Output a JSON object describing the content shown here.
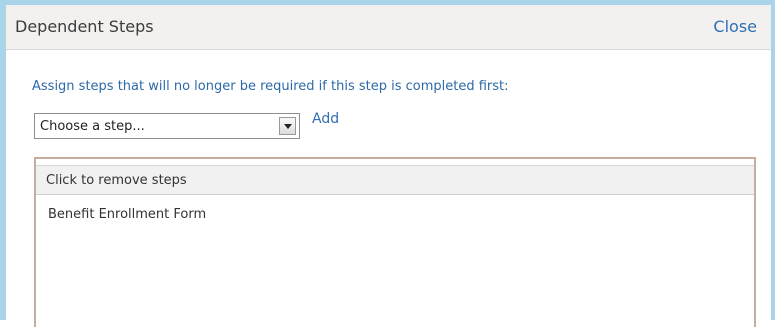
{
  "dialog": {
    "title": "Dependent Steps",
    "close_label": "Close"
  },
  "instructions": "Assign steps that will no longer be required if this step is completed first:",
  "step_select": {
    "selected": "Choose a step..."
  },
  "add_label": "Add",
  "dependent_list": {
    "header": "Click to remove steps",
    "items": [
      {
        "label": "Benefit Enrollment Form"
      }
    ]
  },
  "colors": {
    "frame_border": "#a9d4ea",
    "link": "#2f6fb7",
    "instructions": "#2e6aa8",
    "list_border": "#c8ad9e"
  }
}
